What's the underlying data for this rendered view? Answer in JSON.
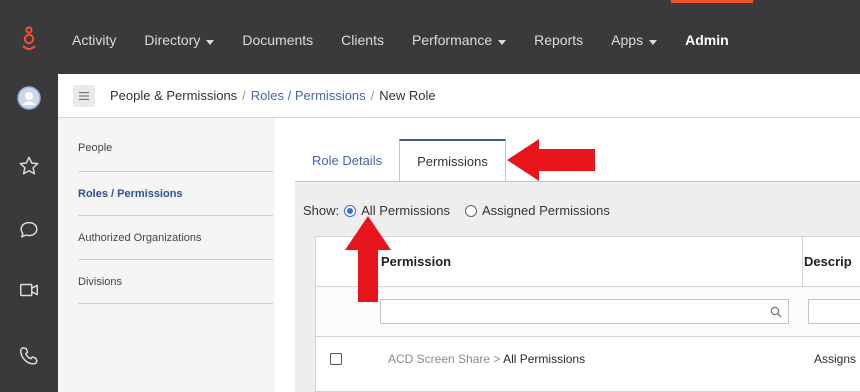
{
  "colors": {
    "brand_accent": "#f0522c",
    "topbar_bg": "#3a3a3c",
    "link": "#4a65a9",
    "annotation_red": "#e8161b"
  },
  "rail": {
    "logo_icon": "genesys-logo-icon",
    "items": [
      {
        "icon": "avatar-icon"
      },
      {
        "icon": "star-icon"
      },
      {
        "icon": "chat-bubble-icon"
      },
      {
        "icon": "video-camera-icon"
      },
      {
        "icon": "phone-icon"
      }
    ]
  },
  "topnav": {
    "items": [
      {
        "label": "Activity"
      },
      {
        "label": "Directory"
      },
      {
        "label": "Documents"
      },
      {
        "label": "Clients"
      },
      {
        "label": "Performance"
      },
      {
        "label": "Reports"
      },
      {
        "label": "Apps"
      },
      {
        "label": "Admin"
      }
    ]
  },
  "breadcrumb": {
    "menu_icon": "hamburger-menu-icon",
    "items": [
      "People & Permissions",
      "Roles / Permissions",
      "New Role"
    ],
    "separator": "/"
  },
  "sidebar": {
    "items": [
      {
        "label": "People"
      },
      {
        "label": "Roles / Permissions"
      },
      {
        "label": "Authorized Organizations"
      },
      {
        "label": "Divisions"
      }
    ],
    "active": "Roles / Permissions"
  },
  "tabs": {
    "items": [
      "Role Details",
      "Permissions"
    ],
    "selected": "Permissions"
  },
  "filter": {
    "show_label": "Show:",
    "options": [
      "All Permissions",
      "Assigned Permissions"
    ],
    "selected": "All Permissions"
  },
  "table": {
    "columns": [
      "Permission",
      "Descrip"
    ],
    "search_icon": "search-icon",
    "search_placeholder": "",
    "rows": [
      {
        "category": "ACD Screen Share",
        "separator": ">",
        "permission": "All Permissions",
        "description": "Assigns",
        "checked": false
      }
    ]
  }
}
